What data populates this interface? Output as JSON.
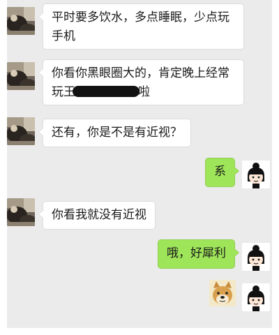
{
  "chat": {
    "messages": [
      {
        "side": "incoming",
        "lines": [
          "平时要多饮水，多点睡眠，少点玩",
          "手机"
        ]
      },
      {
        "side": "incoming",
        "line1": "你看你黑眼圈大的，肯定晚上经常",
        "line2_prefix": "玩王",
        "line2_suffix": "啦"
      },
      {
        "side": "incoming",
        "text": "还有，你是不是有近视？"
      },
      {
        "side": "outgoing",
        "text": "系"
      },
      {
        "side": "incoming",
        "text": "你看我就没有近视"
      },
      {
        "side": "outgoing",
        "text": "哦，好犀利"
      },
      {
        "side": "outgoing",
        "sticker": "doge-sticker"
      }
    ]
  },
  "colors": {
    "background": "#ebebeb",
    "incoming_bubble": "#ffffff",
    "outgoing_bubble": "#9fe55a"
  },
  "icons": {
    "contact_avatar": "contact-avatar-icon",
    "self_avatar": "cartoon-girl-avatar-icon",
    "sticker": "doge-sticker-icon"
  }
}
